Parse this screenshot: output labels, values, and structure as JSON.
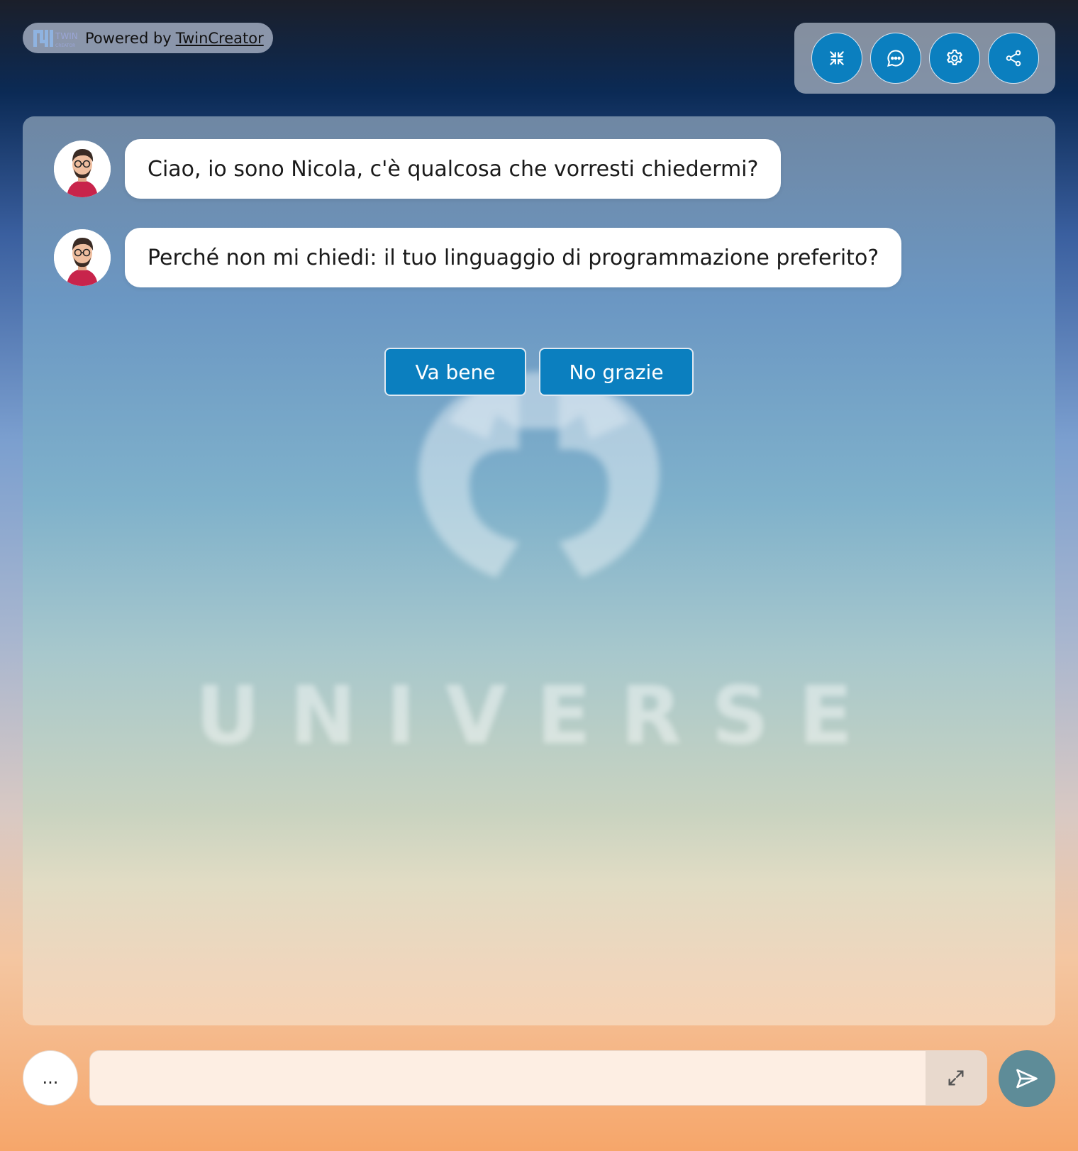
{
  "header": {
    "logo_text_top": "TWIN",
    "logo_text_bottom": "CREATOR",
    "powered_prefix": "Powered by",
    "powered_link": "TwinCreator"
  },
  "toolbar": {
    "buttons": [
      {
        "icon": "collapse-icon"
      },
      {
        "icon": "chat-bubble-icon"
      },
      {
        "icon": "gear-icon"
      },
      {
        "icon": "share-icon"
      }
    ],
    "accent_color": "#0b7fbf"
  },
  "chat": {
    "messages": [
      {
        "sender": "Nicola",
        "text": "Ciao, io sono Nicola, c'è qualcosa che vorresti chiedermi?"
      },
      {
        "sender": "Nicola",
        "text": "Perché non mi chiedi: il tuo linguaggio di programmazione preferito?"
      }
    ],
    "choices": [
      "Va bene",
      "No grazie"
    ],
    "background_watermark": "UNIVERSE"
  },
  "composer": {
    "options_label": "...",
    "input_value": "",
    "input_placeholder": "",
    "send_color": "#5e8c98"
  }
}
